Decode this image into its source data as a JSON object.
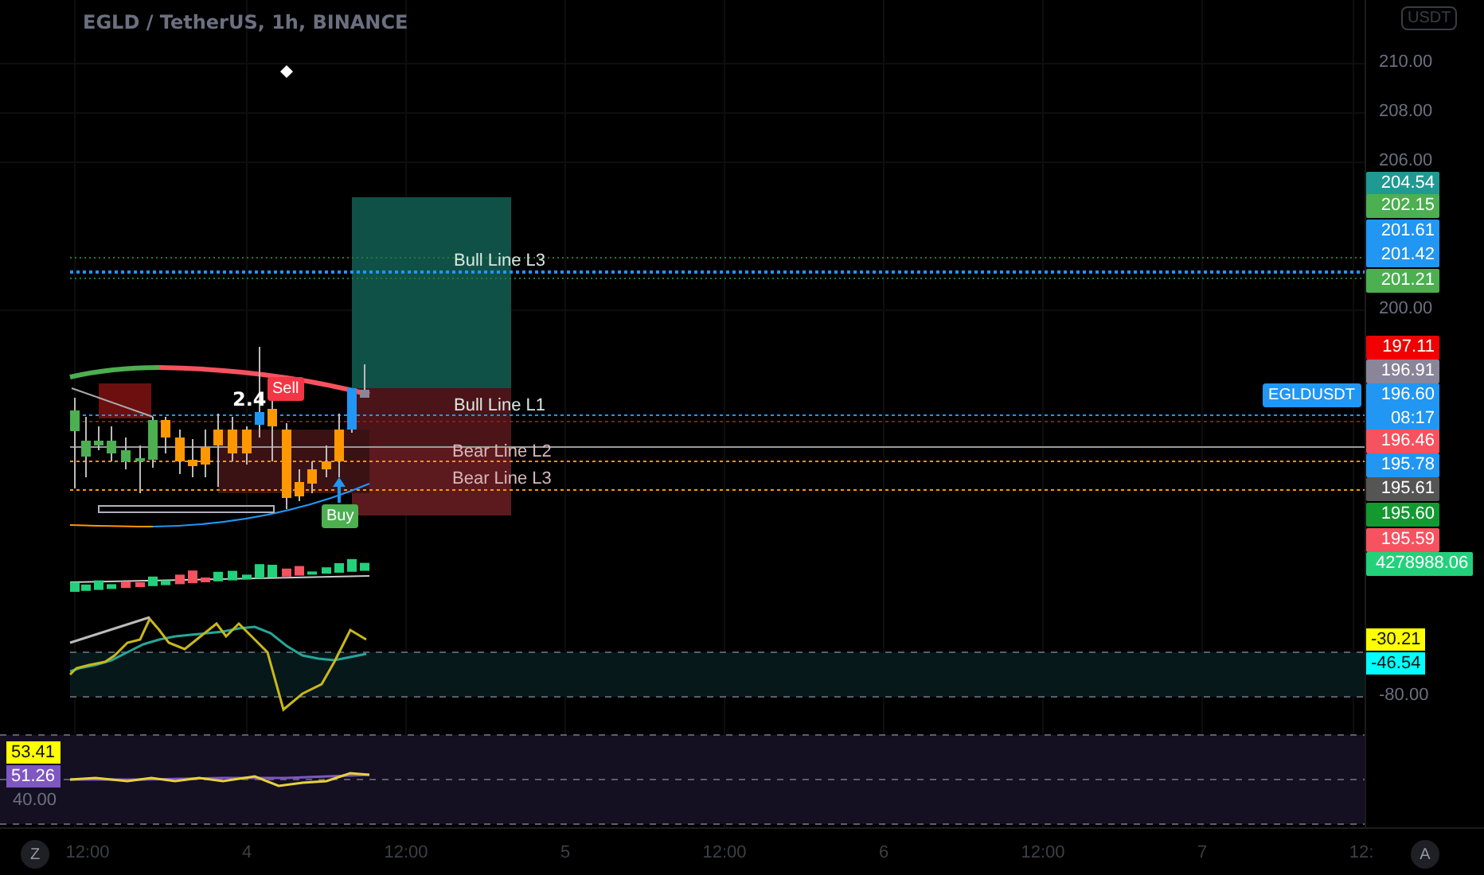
{
  "legend": {
    "title": "EGLD / TetherUS, 1h, BINANCE"
  },
  "chart": {
    "markers": [
      {
        "kind": "sell",
        "label": "Sell"
      },
      {
        "kind": "value",
        "label": "2.4"
      },
      {
        "kind": "buy",
        "label": "Buy"
      }
    ],
    "level_lines": [
      {
        "label": "Bull Line L3"
      },
      {
        "label": "Bull Line L1"
      },
      {
        "label": "Bear Line L2"
      },
      {
        "label": "Bear Line L3"
      }
    ]
  },
  "price_axis": {
    "currency": "USDT",
    "ticks": [
      "210.00",
      "208.00",
      "206.00",
      "200.00"
    ],
    "symbol_tag": "EGLDUSDT",
    "labels": [
      {
        "values": [
          "204.54"
        ],
        "color": "#1e9a92"
      },
      {
        "values": [
          "202.15"
        ],
        "color": "#4caf50"
      },
      {
        "values": [
          "201.61",
          "201.42"
        ],
        "color": "#2196f3"
      },
      {
        "values": [
          "201.21"
        ],
        "color": "#4caf50"
      },
      {
        "values": [
          "197.11"
        ],
        "color": "#f00000"
      },
      {
        "values": [
          "196.91"
        ],
        "color": "#8a8599"
      },
      {
        "values": [
          "196.60",
          "08:17"
        ],
        "color": "#2196f3"
      },
      {
        "values": [
          "196.46"
        ],
        "color": "#f7525f"
      },
      {
        "values": [
          "195.78"
        ],
        "color": "#2196f3"
      },
      {
        "values": [
          "195.61"
        ],
        "color": "#555555"
      },
      {
        "values": [
          "195.60"
        ],
        "color": "#129a30"
      },
      {
        "values": [
          "195.59"
        ],
        "color": "#f7525f"
      },
      {
        "values": [
          "4278988.06"
        ],
        "color": "#22d17a"
      }
    ]
  },
  "oscillator": {
    "labels": [
      {
        "value": "-30.21",
        "color": "#ffff00"
      },
      {
        "value": "-46.54",
        "color": "#00ffff"
      }
    ],
    "tick": "-80.00"
  },
  "rsi": {
    "labels": [
      {
        "value": "53.41",
        "color": "#ffff00"
      },
      {
        "value": "51.26",
        "color": "#7e57c2"
      }
    ],
    "tick": "40.00"
  },
  "time_axis": {
    "labels": [
      "12:00",
      "4",
      "12:00",
      "5",
      "12:00",
      "6",
      "12:00",
      "7",
      "12:"
    ],
    "buttons": [
      "Z",
      "A"
    ]
  }
}
